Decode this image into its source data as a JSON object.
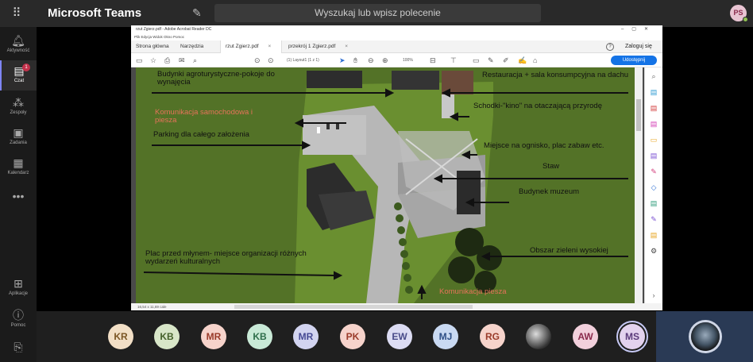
{
  "app": {
    "title": "Microsoft Teams"
  },
  "search": {
    "placeholder": "Wyszukaj lub wpisz polecenie"
  },
  "me": {
    "initials": "PS",
    "status_color": "#92c353"
  },
  "rail": {
    "items": [
      {
        "label": "Aktywność",
        "icon": "bell-icon"
      },
      {
        "label": "Czat",
        "icon": "chat-icon",
        "badge": "1"
      },
      {
        "label": "Zespoły",
        "icon": "teams-icon"
      },
      {
        "label": "Zadania",
        "icon": "tasks-icon"
      },
      {
        "label": "Kalendarz",
        "icon": "calendar-icon"
      }
    ],
    "more": "•••",
    "apps_label": "Aplikacje",
    "help_label": "Pomoc"
  },
  "acrobat": {
    "window_title": "rzut Zgierz.pdf - Adobe Acrobat Reader DC",
    "menu": "Plik  Edycja  Widok  Okno  Pomoc",
    "tabs": {
      "home": "Strona główna",
      "tools": "Narzędzia",
      "doc1": "rzut Zgierz.pdf",
      "doc2": "przekrój 1 Zgierz.pdf"
    },
    "login": "Zaloguj się",
    "page_indicator": "(1) Layout1  (1 z 1)",
    "zoom": "100%",
    "share": "Udostępnij",
    "status": "16,54 x 11,69 cale"
  },
  "plan": {
    "labels": [
      "Budynki agroturystyczne-pokoje do wynajęcia",
      "Komunikacja samochodowa i piesza",
      "Parking dla całego założenia",
      "Restauracja + sala konsumpcyjna na dachu",
      "Schodki-\"kino\" na otaczającą przyrodę",
      "Miejsce na ognisko, plac zabaw etc.",
      "Staw",
      "Budynek muzeum",
      "Obszar zieleni wysokiej",
      "Plac przed młynem- miejsce organizacji różnych wydarzeń kulturalnych",
      "Komunikacja piesza"
    ],
    "accent": "#e6735a"
  },
  "participants": [
    {
      "initials": "KR",
      "bg": "#f2dfc6",
      "fg": "#7a5524"
    },
    {
      "initials": "KB",
      "bg": "#d8e6c8",
      "fg": "#45612a"
    },
    {
      "initials": "MR",
      "bg": "#f6d3cb",
      "fg": "#9a3b2a"
    },
    {
      "initials": "KB",
      "bg": "#c9ead7",
      "fg": "#2f6e4b"
    },
    {
      "initials": "MR",
      "bg": "#d2d4f0",
      "fg": "#464a94"
    },
    {
      "initials": "PK",
      "bg": "#f6d3cb",
      "fg": "#9a3b2a"
    },
    {
      "initials": "EW",
      "bg": "#dcdcf3",
      "fg": "#4a4c8a"
    },
    {
      "initials": "MJ",
      "bg": "#c9d9f2",
      "fg": "#2f4f86"
    },
    {
      "initials": "RG",
      "bg": "#f6d3cb",
      "fg": "#9a3b2a"
    },
    {
      "initials": "",
      "photo": true
    },
    {
      "initials": "AW",
      "bg": "#f2d0dc",
      "fg": "#8a2a4c"
    },
    {
      "initials": "MS",
      "bg": "#e3d2ee",
      "fg": "#5a3a7a",
      "selected": true
    }
  ]
}
